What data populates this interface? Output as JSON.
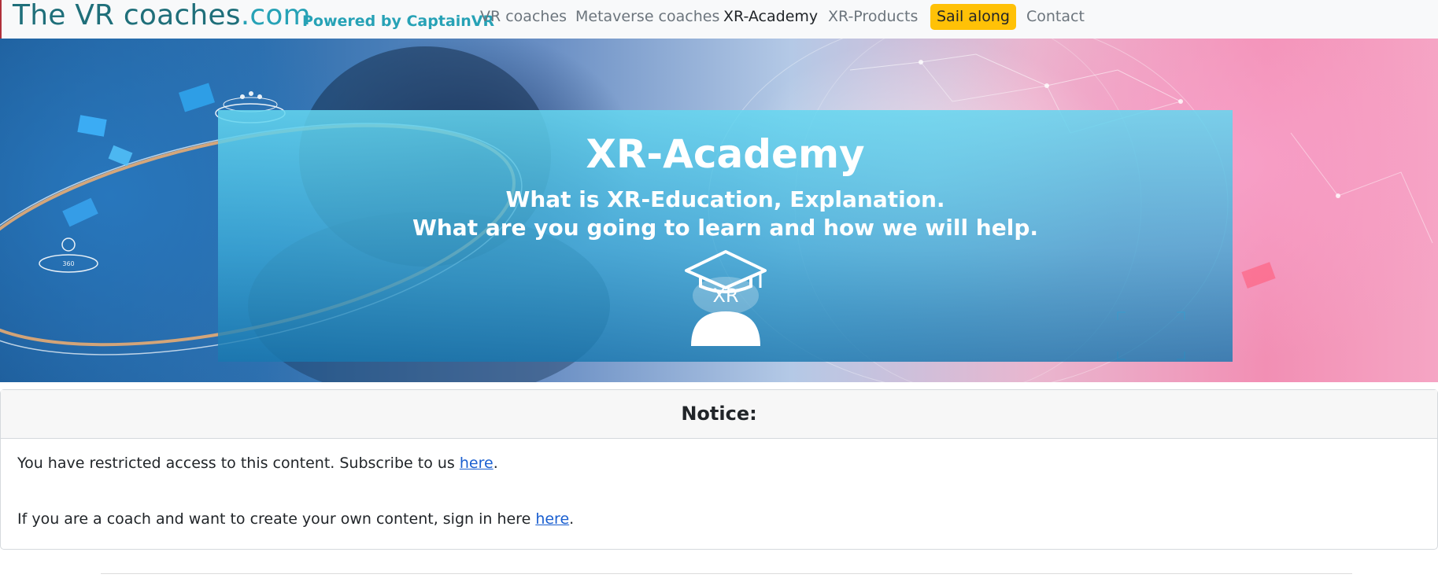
{
  "navbar": {
    "brand": "The VR coaches",
    "brand_suffix": ".com",
    "powered_by": "Powered by CaptainVR",
    "links": [
      {
        "label": "VR coaches"
      },
      {
        "label": "Metaverse coaches"
      },
      {
        "label": "XR-Academy",
        "active": true
      },
      {
        "label": "XR-Products"
      },
      {
        "label": "Sail along",
        "highlight": true
      },
      {
        "label": "Contact"
      }
    ]
  },
  "hero": {
    "title": "XR-Academy",
    "subtitle_line1": "What is XR-Education, Explanation.",
    "subtitle_line2": "What are you going to learn and how we will help.",
    "logo_text": "XR",
    "badge_360": "360"
  },
  "notice": {
    "heading": "Notice:",
    "line1_text": "You have restricted access to this content. Subscribe to us ",
    "line1_link": "here",
    "line1_end": ".",
    "line2_text": "If you are a coach and want to create your own content, sign in here ",
    "line2_link": "here",
    "line2_end": "."
  },
  "colors": {
    "brand": "#1f6f7a",
    "brand_accent": "#27a2b6",
    "highlight": "#ffc107",
    "link": "#1a5fd0"
  }
}
